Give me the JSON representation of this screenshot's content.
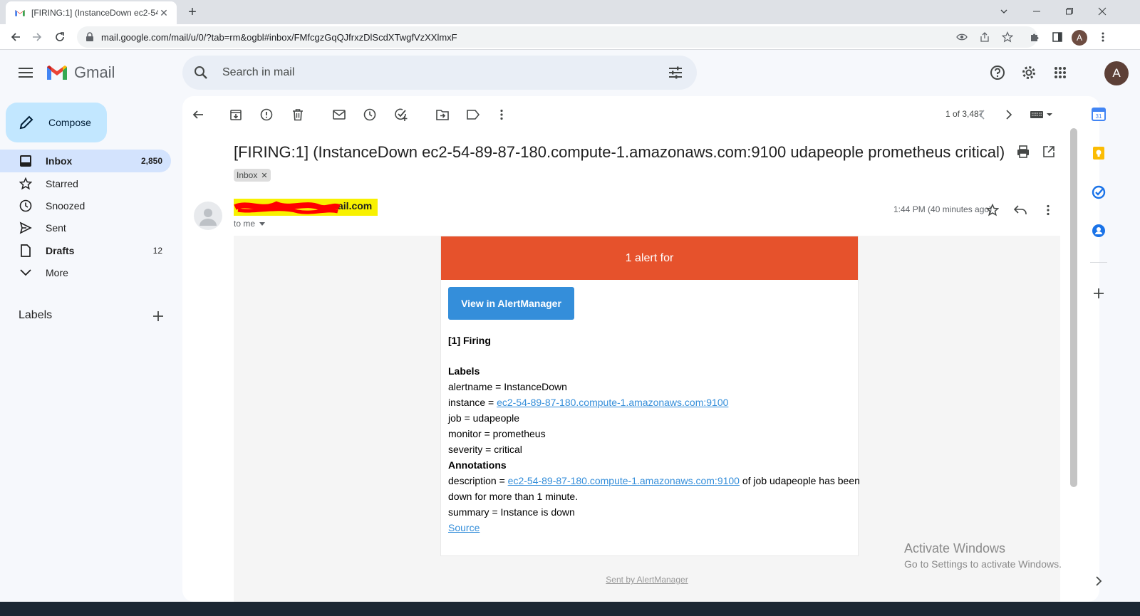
{
  "browser": {
    "tab_title": "[FIRING:1] (InstanceDown ec2-54",
    "url": "mail.google.com/mail/u/0/?tab=rm&ogbl#inbox/FMfcgzGqQJfrxzDlScdXTwgfVzXXlmxF",
    "profile_initial": "A"
  },
  "app": {
    "name": "Gmail"
  },
  "search": {
    "placeholder": "Search in mail"
  },
  "header": {
    "avatar_initial": "A"
  },
  "compose": {
    "label": "Compose"
  },
  "nav": [
    {
      "label": "Inbox",
      "count": "2,850"
    },
    {
      "label": "Starred",
      "count": ""
    },
    {
      "label": "Snoozed",
      "count": ""
    },
    {
      "label": "Sent",
      "count": ""
    },
    {
      "label": "Drafts",
      "count": "12"
    },
    {
      "label": "More",
      "count": ""
    }
  ],
  "labels_header": "Labels",
  "pager": {
    "text": "1 of 3,487"
  },
  "message": {
    "subject": "[FIRING:1] (InstanceDown ec2-54-89-87-180.compute-1.amazonaws.com:9100 udapeople prometheus critical)",
    "chip": "Inbox",
    "sender_visible": "ail.com",
    "to": "to me",
    "time": "1:44 PM (40 minutes ago)"
  },
  "alert": {
    "header": "1 alert for",
    "button": "View in AlertManager",
    "firing": "[1] Firing",
    "labels_title": "Labels",
    "alertname": "alertname = InstanceDown",
    "instance_prefix": "instance = ",
    "instance_link": "ec2-54-89-87-180.compute-1.amazonaws.com:9100",
    "job": "job = udapeople",
    "monitor": "monitor = prometheus",
    "severity": "severity = critical",
    "annotations_title": "Annotations",
    "description_prefix": "description = ",
    "description_link": "ec2-54-89-87-180.compute-1.amazonaws.com:9100",
    "description_suffix": " of job udapeople has been",
    "description_line2": "down for more than 1 minute.",
    "summary": "summary = Instance is down",
    "source": "Source",
    "sent_by": "Sent by AlertManager"
  },
  "watermark": {
    "line1": "Activate Windows",
    "line2": "Go to Settings to activate Windows."
  },
  "colors": {
    "alert_header": "#e6522c",
    "button": "#348eda",
    "active_nav": "#d3e3fd",
    "compose": "#c2e7ff"
  }
}
